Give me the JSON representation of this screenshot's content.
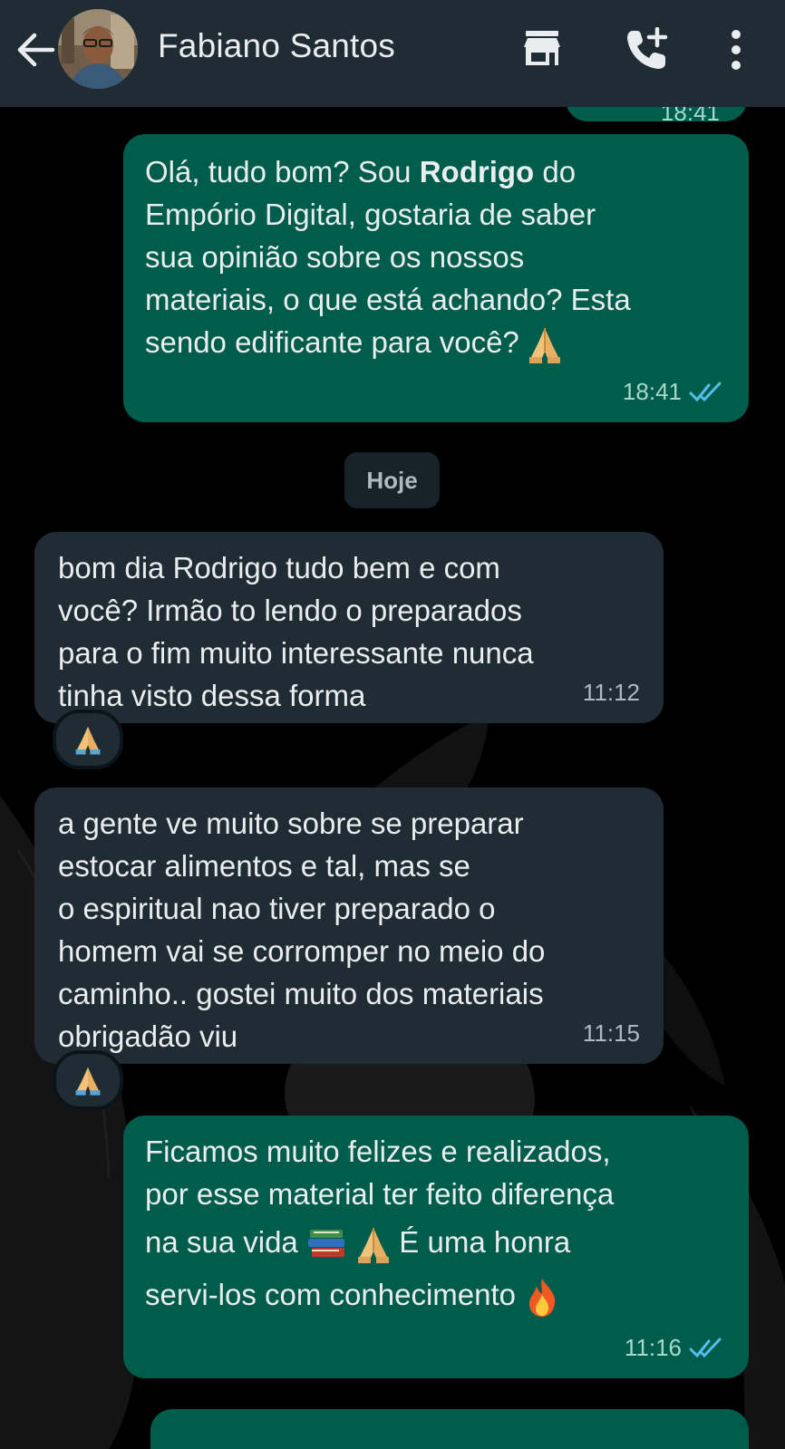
{
  "header": {
    "contact_name": "Fabiano Santos",
    "icons": [
      "back-arrow-icon",
      "avatar",
      "shop-icon",
      "add-call-icon",
      "more-vert-icon"
    ]
  },
  "colors": {
    "header_bg": "#1f2c34",
    "outgoing_bubble": "#005c4b",
    "incoming_bubble": "#202c33",
    "read_ticks": "#53bdeb",
    "chat_bg": "#000000"
  },
  "top_partial_message": {
    "time": "18:41"
  },
  "messages": [
    {
      "direction": "out",
      "text_before_bold": "Olá, tudo bom? Sou ",
      "bold": "Rodrigo",
      "text_after_bold": " do\nEmpório Digital, gostaria de saber\nsua opinião sobre os nossos\nmateriais, o que está achando? Esta\nsendo edificante para você? ",
      "emoji": "folded-hands",
      "time": "18:41",
      "status": "read"
    },
    {
      "direction": "in",
      "text": "bom dia Rodrigo tudo bem e com\nvocê? Irmão to lendo o preparados\npara o fim muito interessante nunca\ntinha visto dessa forma",
      "time": "11:12",
      "reaction": "folded-hands"
    },
    {
      "direction": "in",
      "text": "a gente ve muito sobre se preparar\nestocar alimentos e tal, mas se\no espiritual nao tiver preparado o\nhomem vai se corromper no meio do\ncaminho.. gostei muito dos materiais\nobrigadão viu",
      "time": "11:15",
      "reaction": "folded-hands"
    },
    {
      "direction": "out",
      "line1": "Ficamos muito felizes e realizados,",
      "line2": "por esse material ter feito diferença",
      "line3a": "na sua vida ",
      "line3b": " É uma honra",
      "line4": "servi-los com conhecimento ",
      "emojis": [
        "books",
        "folded-hands",
        "fire"
      ],
      "time": "11:16",
      "status": "read"
    }
  ],
  "date_divider": "Hoje"
}
